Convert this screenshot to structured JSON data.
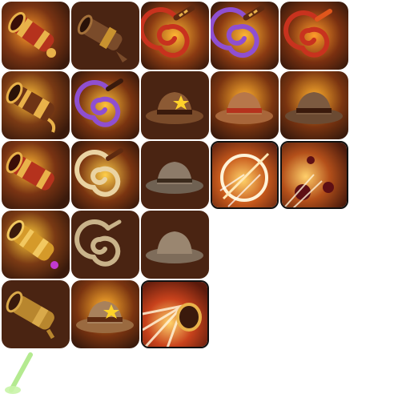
{
  "sheet": {
    "background": "#ffffff"
  },
  "palette": {
    "tile_dark": "#3a1d10",
    "tile_warm": "#6e3415",
    "glow": "#ffb02e",
    "gold": "#e9b24a",
    "brass": "#c9922f",
    "leather_red": "#b5321d",
    "leather_brown": "#7a4b2a",
    "whip_purple": "#8f4fd0",
    "whip_red": "#c8321e",
    "whip_cream": "#ead3a2",
    "hat_tan": "#a8815c",
    "hat_grey": "#8d7b69",
    "star": "#ffd22a",
    "bomb": "#5e0f14",
    "spark_green": "#9be36b"
  },
  "icons": [
    {
      "row": 0,
      "col": 0,
      "icon": "cannon-icon",
      "variant": "red-gold"
    },
    {
      "row": 0,
      "col": 1,
      "icon": "cannon-icon",
      "variant": "plain-brown"
    },
    {
      "row": 0,
      "col": 2,
      "icon": "whip-icon",
      "variant": "red"
    },
    {
      "row": 0,
      "col": 3,
      "icon": "whip-icon",
      "variant": "purple"
    },
    {
      "row": 0,
      "col": 4,
      "icon": "whip-icon",
      "variant": "red-swirl"
    },
    {
      "row": 1,
      "col": 0,
      "icon": "cannon-icon",
      "variant": "brown-gold"
    },
    {
      "row": 1,
      "col": 1,
      "icon": "whip-icon",
      "variant": "purple-swirl"
    },
    {
      "row": 1,
      "col": 2,
      "icon": "cowboy-hat-icon",
      "variant": "star"
    },
    {
      "row": 1,
      "col": 3,
      "icon": "cowboy-hat-icon",
      "variant": "red-band"
    },
    {
      "row": 1,
      "col": 4,
      "icon": "cowboy-hat-icon",
      "variant": "brown"
    },
    {
      "row": 2,
      "col": 0,
      "icon": "cannon-icon",
      "variant": "red-glow"
    },
    {
      "row": 2,
      "col": 1,
      "icon": "whip-icon",
      "variant": "cream-glow"
    },
    {
      "row": 2,
      "col": 2,
      "icon": "cowboy-hat-icon",
      "variant": "grey"
    },
    {
      "row": 2,
      "col": 3,
      "icon": "whip-lash-skill-icon",
      "variant": "framed"
    },
    {
      "row": 2,
      "col": 4,
      "icon": "cannonball-skill-icon",
      "variant": "framed"
    },
    {
      "row": 3,
      "col": 0,
      "icon": "cannon-icon",
      "variant": "gold-purple"
    },
    {
      "row": 3,
      "col": 1,
      "icon": "whip-icon",
      "variant": "plain-cream"
    },
    {
      "row": 3,
      "col": 2,
      "icon": "cowboy-hat-icon",
      "variant": "plain-grey"
    },
    {
      "row": 4,
      "col": 0,
      "icon": "cannon-icon",
      "variant": "plain-gold"
    },
    {
      "row": 4,
      "col": 1,
      "icon": "cowboy-hat-icon",
      "variant": "star-tan"
    },
    {
      "row": 4,
      "col": 2,
      "icon": "cannon-blast-skill-icon",
      "variant": "framed"
    }
  ],
  "extra": {
    "icon": "light-beam-icon"
  }
}
